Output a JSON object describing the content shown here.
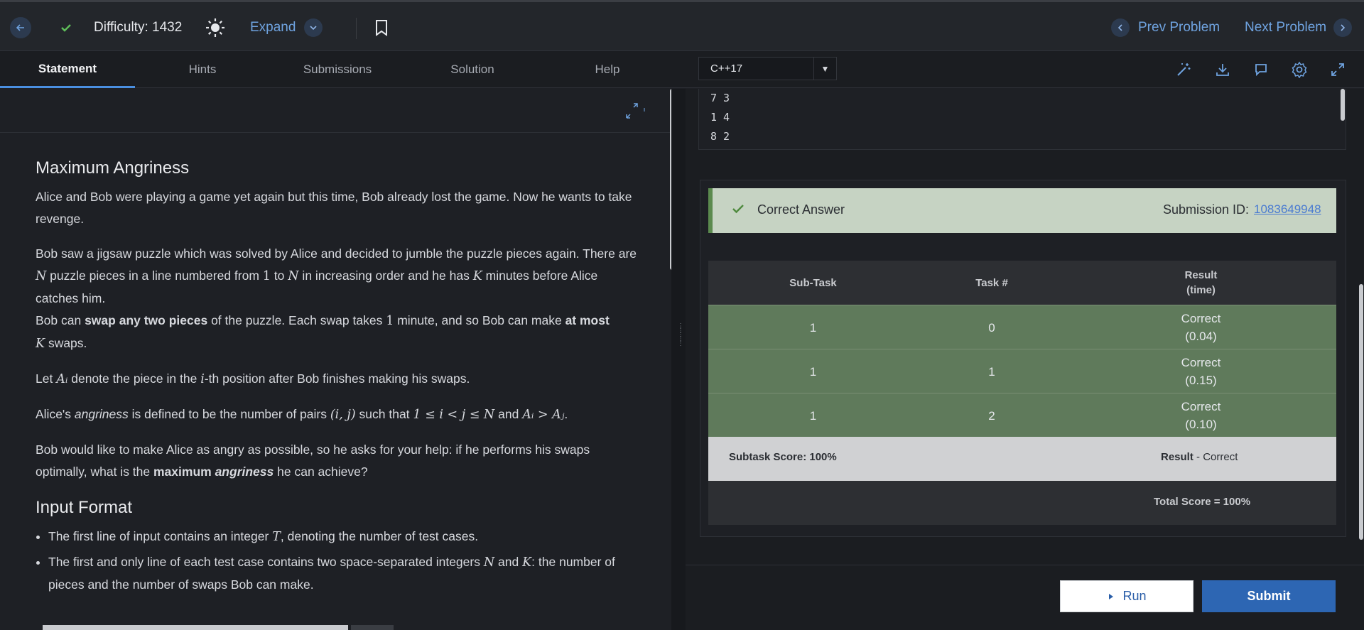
{
  "header": {
    "difficulty_label": "Difficulty: 1432",
    "expand_label": "Expand",
    "prev_label": "Prev Problem",
    "next_label": "Next Problem"
  },
  "tabs": {
    "statement": "Statement",
    "hints": "Hints",
    "submissions": "Submissions",
    "solution": "Solution",
    "help": "Help"
  },
  "editor": {
    "language": "C++17"
  },
  "problem": {
    "title": "Maximum Angriness",
    "p1": "Alice and Bob were playing a game yet again but this time, Bob already lost the game. Now he wants to take revenge.",
    "p2_a": "Bob saw a jigsaw puzzle which was solved by Alice and decided to jumble the puzzle pieces again. There are ",
    "p2_N": "N",
    "p2_b": " puzzle pieces in a line numbered from ",
    "p2_one": "1",
    "p2_c": " to ",
    "p2_N2": "N",
    "p2_d": " in increasing order and he has ",
    "p2_K": "K",
    "p2_e": " minutes before Alice catches him.",
    "p3_a": "Bob can ",
    "p3_bold1": "swap any two pieces",
    "p3_b": " of the puzzle. Each swap takes ",
    "p3_one": "1",
    "p3_c": " minute, and so Bob can make ",
    "p3_bold2": "at most",
    "p3_K": "K",
    "p3_d": " swaps.",
    "p4_a": "Let ",
    "p4_Ai": "Aᵢ",
    "p4_b": " denote the piece in the ",
    "p4_i": "i",
    "p4_c": "-th position after Bob finishes making his swaps.",
    "p5_a": "Alice's ",
    "p5_em": "angriness",
    "p5_b": " is defined to be the number of pairs ",
    "p5_pair": "(i, j)",
    "p5_c": " such that ",
    "p5_cond": "1 ≤ i < j ≤ N",
    "p5_d": " and ",
    "p5_cond2": "Aᵢ > Aⱼ",
    "p5_e": ".",
    "p6_a": "Bob would like to make Alice as angry as possible, so he asks for your help: if he performs his swaps optimally, what is the ",
    "p6_bold": "maximum",
    "p6_em": "angriness",
    "p6_b": " he can achieve?",
    "input_title": "Input Format",
    "li1_a": "The first line of input contains an integer ",
    "li1_T": "T",
    "li1_b": ", denoting the number of test cases.",
    "li2_a": "The first and only line of each test case contains two space-separated integers ",
    "li2_N": "N",
    "li2_and": " and ",
    "li2_K": "K",
    "li2_b": ": the number of pieces and the number of swaps Bob can make."
  },
  "io_lines": [
    "7 3",
    "1 4",
    "8 2"
  ],
  "result": {
    "status": "Correct Answer",
    "submission_label": "Submission ID:",
    "submission_id": "1083649948",
    "headers": {
      "subtask": "Sub-Task",
      "task": "Task #",
      "result_line1": "Result",
      "result_line2": "(time)"
    },
    "rows": [
      {
        "subtask": "1",
        "task": "0",
        "result": "Correct",
        "time": "(0.04)"
      },
      {
        "subtask": "1",
        "task": "1",
        "result": "Correct",
        "time": "(0.15)"
      },
      {
        "subtask": "1",
        "task": "2",
        "result": "Correct",
        "time": "(0.10)"
      }
    ],
    "subtask_score": "Subtask Score: 100%",
    "result_label": "Result",
    "result_sep": " - ",
    "result_value": "Correct",
    "total_score": "Total Score = 100%"
  },
  "actions": {
    "run_label": "Run",
    "submit_label": "Submit"
  },
  "colors": {
    "accent": "#4a8fe0",
    "correct_row": "#5f7a5b",
    "banner_bg": "#c6d3c3",
    "submit_bg": "#2d66b3"
  }
}
